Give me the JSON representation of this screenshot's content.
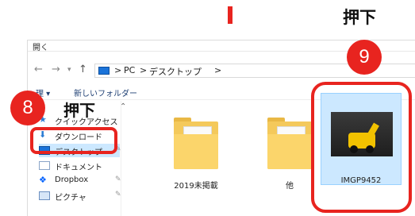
{
  "annotations": {
    "top_press_label": "押下",
    "step8_number": "8",
    "step8_press_label": "押下",
    "step9_number": "9"
  },
  "window": {
    "title": "開く",
    "breadcrumb": [
      "PC",
      "デスクトップ"
    ],
    "separators": [
      ">",
      ">",
      ">"
    ]
  },
  "ribbon": {
    "organize_label": "理 ▾",
    "new_folder_label": "新しいフォルダー"
  },
  "sidebar": {
    "items": [
      {
        "label": "クイックアクセス",
        "icon": "star-icon"
      },
      {
        "label": "ダウンロード",
        "icon": "download-icon"
      },
      {
        "label": "デスクトップ",
        "icon": "desktop-icon",
        "selected": true
      },
      {
        "label": "ドキュメント",
        "icon": "document-icon"
      },
      {
        "label": "Dropbox",
        "icon": "dropbox-icon"
      },
      {
        "label": "ピクチャ",
        "icon": "pictures-icon"
      }
    ],
    "pin_glyph": "📌"
  },
  "content": {
    "items": [
      {
        "label": "2019未掲載",
        "type": "folder"
      },
      {
        "label": "他",
        "type": "folder"
      },
      {
        "label": "IMGP9452",
        "type": "image",
        "selected": true
      }
    ]
  },
  "colors": {
    "accent_red": "#e8241f",
    "selection_blue": "#cce8ff",
    "folder_yellow": "#f4c95b"
  }
}
